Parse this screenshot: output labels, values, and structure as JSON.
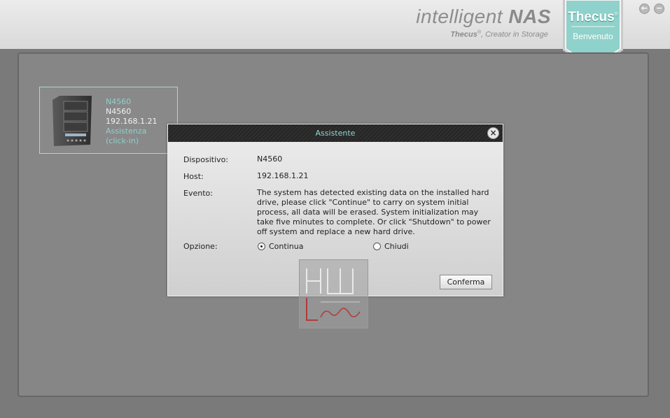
{
  "header": {
    "brand_prefix": "i",
    "brand_word": "ntelligent ",
    "brand_strong": "NAS",
    "tagline_brand": "Thecus",
    "tagline_mark": "®",
    "tagline_rest": ", Creator in Storage",
    "badge_title": "Thecus",
    "badge_mark": "®",
    "badge_sub": "Benvenuto",
    "back_glyph": "←",
    "minimize_glyph": "−",
    "badge_color": "#8fd1cb"
  },
  "device": {
    "name_link": "N4560",
    "name": "N4560",
    "ip": "192.168.1.21",
    "assist_line1": "Assistenza",
    "assist_line2": "(click-in)"
  },
  "dialog": {
    "title": "Assistente",
    "close_glyph": "×",
    "device_label": "Dispositivo:",
    "device_value": "N4560",
    "host_label": "Host:",
    "host_value": "192.168.1.21",
    "event_label": "Evento:",
    "event_text": "The system has detected existing data on the installed hard drive, please click \"Continue\" to carry on system initial process, all data will be erased. System initialization may take five minutes to complete. Or click \"Shutdown\" to power off system and replace a new hard drive.",
    "option_label": "Opzione:",
    "option_continue": "Continua",
    "option_close": "Chiudi",
    "selected_option": "Continua",
    "confirm_label": "Conferma"
  },
  "watermark": {
    "line1": "HW",
    "line2": "Legend"
  }
}
